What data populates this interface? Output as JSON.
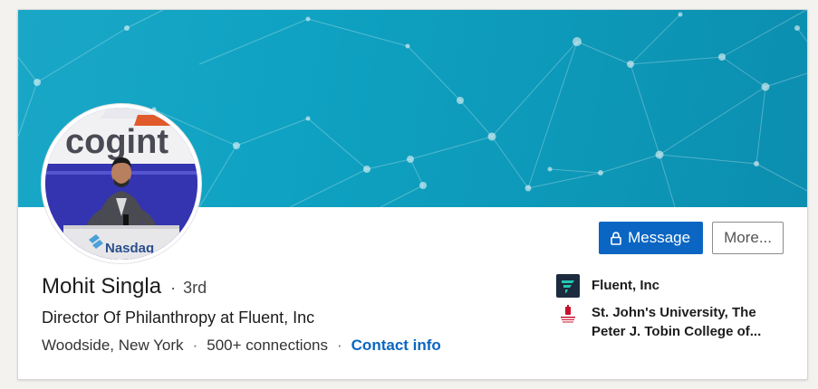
{
  "profile": {
    "name": "Mohit Singla",
    "degree": "3rd",
    "degree_separator": "·",
    "headline": "Director Of Philanthropy at Fluent, Inc",
    "location": "Woodside, New York",
    "connections": "500+ connections",
    "contact_link": "Contact info",
    "meta_separator": "·"
  },
  "avatar": {
    "sign_text": "cogint",
    "podium_text": "Nasdaq"
  },
  "actions": {
    "message_label": "Message",
    "more_label": "More..."
  },
  "experience": [
    {
      "label": "Fluent, Inc",
      "logo_icon": "fluent-logo-icon"
    },
    {
      "label_line1": "St. John's University, The",
      "label_line2": "Peter J. Tobin College of...",
      "logo_icon": "st-johns-logo-icon"
    }
  ],
  "colors": {
    "primary": "#0a66c2",
    "banner": "#0fa2c2",
    "fluent_logo_bg": "#1c2b3d",
    "fluent_logo_mark": "#25c7b4",
    "st_johns_red": "#c8102e"
  }
}
